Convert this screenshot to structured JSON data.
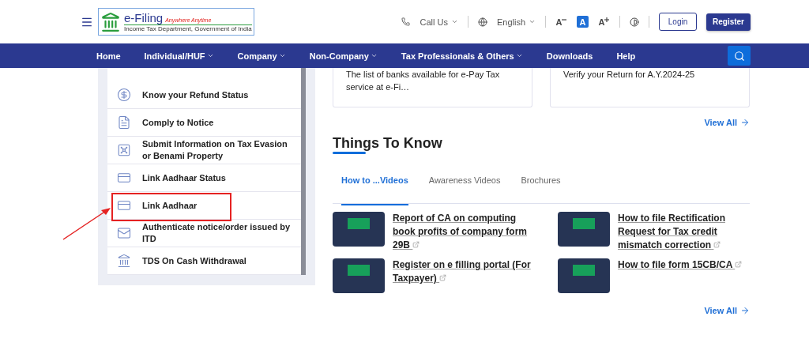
{
  "header": {
    "logo": {
      "title": "e-Filing",
      "tagline": "Anywhere Anytime",
      "subtitle": "Income Tax Department, Government of India"
    },
    "call_us": "Call Us",
    "language": "English",
    "font_sizes": [
      {
        "label": "A",
        "kind": "decrease",
        "selected": false
      },
      {
        "label": "A",
        "kind": "normal",
        "selected": true
      },
      {
        "label": "A",
        "kind": "increase",
        "selected": false
      }
    ],
    "login": "Login",
    "register": "Register"
  },
  "nav": [
    {
      "label": "Home",
      "dropdown": false
    },
    {
      "label": "Individual/HUF",
      "dropdown": true
    },
    {
      "label": "Company",
      "dropdown": true
    },
    {
      "label": "Non-Company",
      "dropdown": true
    },
    {
      "label": "Tax Professionals & Others",
      "dropdown": true
    },
    {
      "label": "Downloads",
      "dropdown": false
    },
    {
      "label": "Help",
      "dropdown": false
    }
  ],
  "quick_links": [
    {
      "label": "Know your Refund Status",
      "highlighted": false
    },
    {
      "label": "Comply to Notice",
      "highlighted": false
    },
    {
      "label": "Submit Information on Tax Evasion or Benami Property",
      "highlighted": false
    },
    {
      "label": "Link Aadhaar Status",
      "highlighted": false
    },
    {
      "label": "Link Aadhaar",
      "highlighted": true
    },
    {
      "label": "Authenticate notice/order issued by ITD",
      "highlighted": false
    },
    {
      "label": "TDS On Cash Withdrawal",
      "highlighted": false
    }
  ],
  "news_cards": [
    {
      "text": "The list of banks available for e-Pay Tax service at e-Fi…"
    },
    {
      "text": "Verify your Return for A.Y.2024-25"
    }
  ],
  "news_view_all": "View All",
  "things_to_know": {
    "title": "Things To Know",
    "tabs": [
      {
        "label": "How to ...Videos",
        "selected": true
      },
      {
        "label": "Awareness Videos",
        "selected": false
      },
      {
        "label": "Brochures",
        "selected": false
      }
    ],
    "videos": [
      {
        "title": "Report of CA on computing book profits of company form 29B"
      },
      {
        "title": "How to file Rectification Request for Tax credit mismatch correction"
      },
      {
        "title": "Register on e filling portal (For Taxpayer)"
      },
      {
        "title": "How to file form 15CB/CA"
      }
    ],
    "view_all": "View All"
  }
}
